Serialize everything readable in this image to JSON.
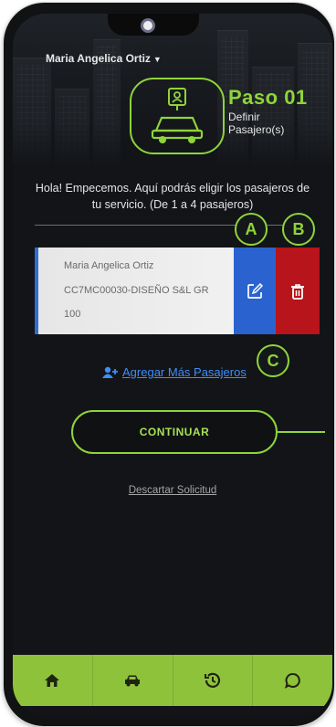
{
  "header": {
    "user_name": "Maria Angelica Ortiz",
    "step_title": "Paso 01",
    "step_subtitle_1": "Definir",
    "step_subtitle_2": "Pasajero(s)"
  },
  "intro": {
    "text": "Hola! Empecemos. Aquí podrás eligir los pasajeros de tu servicio. (De 1 a 4 pasajeros)"
  },
  "badges": {
    "a": "A",
    "b": "B",
    "c": "C"
  },
  "passenger": {
    "name": "Maria Angelica Ortiz",
    "company": "CC7MC00030-DISEÑO S&L GR",
    "code": "100"
  },
  "actions": {
    "add_more": "Agregar Más Pasajeros",
    "continue": "CONTINUAR",
    "discard": "Descartar Solicitud"
  },
  "icons": {
    "dropdown": "chevron-down-icon",
    "step": "user-car-icon",
    "edit": "edit-icon",
    "delete": "trash-icon",
    "add_user": "add-user-icon",
    "nav_home": "home-icon",
    "nav_car": "car-icon",
    "nav_history": "history-icon",
    "nav_chat": "chat-icon"
  },
  "colors": {
    "accent": "#8fd43a",
    "edit": "#2a63cf",
    "delete": "#b8141b",
    "link": "#3f8ef5",
    "nav_bg": "#8fc23b"
  }
}
